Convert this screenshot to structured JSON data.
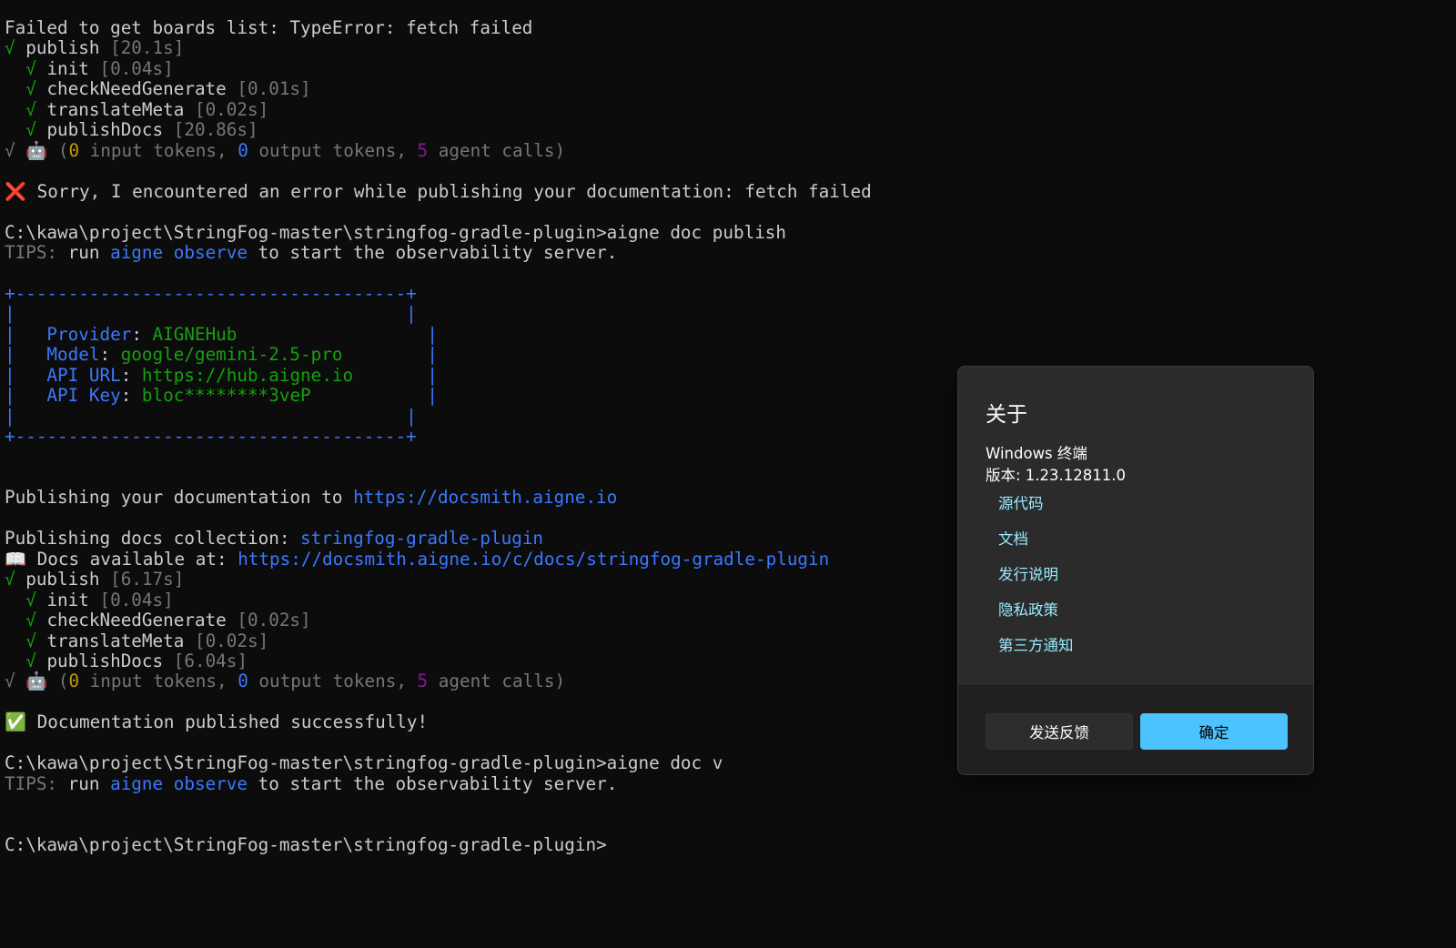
{
  "terminal": {
    "lines": [
      [
        {
          "t": "Failed to get boards list: TypeError: fetch failed",
          "c": "text"
        }
      ],
      [
        {
          "t": "√ ",
          "c": "green"
        },
        {
          "t": "publish ",
          "c": "text"
        },
        {
          "t": "[20.1s]",
          "c": "dim"
        }
      ],
      [
        {
          "t": "  √ ",
          "c": "green"
        },
        {
          "t": "init ",
          "c": "text"
        },
        {
          "t": "[0.04s]",
          "c": "dim"
        }
      ],
      [
        {
          "t": "  √ ",
          "c": "green"
        },
        {
          "t": "checkNeedGenerate ",
          "c": "text"
        },
        {
          "t": "[0.01s]",
          "c": "dim"
        }
      ],
      [
        {
          "t": "  √ ",
          "c": "green"
        },
        {
          "t": "translateMeta ",
          "c": "text"
        },
        {
          "t": "[0.02s]",
          "c": "dim"
        }
      ],
      [
        {
          "t": "  √ ",
          "c": "green"
        },
        {
          "t": "publishDocs ",
          "c": "text"
        },
        {
          "t": "[20.86s]",
          "c": "dim"
        }
      ],
      [
        {
          "t": "√ ",
          "c": "dim"
        },
        {
          "t": "🤖",
          "c": "emoji"
        },
        {
          "t": " (",
          "c": "dim"
        },
        {
          "t": "0",
          "c": "yellow"
        },
        {
          "t": " input tokens, ",
          "c": "dim"
        },
        {
          "t": "0",
          "c": "blue"
        },
        {
          "t": " output tokens, ",
          "c": "dim"
        },
        {
          "t": "5",
          "c": "purple"
        },
        {
          "t": " agent calls)",
          "c": "dim"
        }
      ],
      [],
      [
        {
          "t": "❌",
          "c": "emoji"
        },
        {
          "t": " Sorry, I encountered an error while publishing your documentation: fetch failed",
          "c": "text"
        }
      ],
      [],
      [
        {
          "t": "C:\\kawa\\project\\StringFog-master\\stringfog-gradle-plugin>aigne doc publish",
          "c": "text"
        }
      ],
      [
        {
          "t": "TIPS:",
          "c": "dim"
        },
        {
          "t": " run ",
          "c": "text"
        },
        {
          "t": "aigne observe",
          "c": "blue"
        },
        {
          "t": " to start the observability server.",
          "c": "text"
        }
      ],
      [],
      [
        {
          "t": "+-------------------------------------+",
          "c": "blue"
        }
      ],
      [
        {
          "t": "|                                     |",
          "c": "blue"
        }
      ],
      [
        {
          "t": "|   Provider",
          "c": "blue"
        },
        {
          "t": ": ",
          "c": "text"
        },
        {
          "t": "AIGNEHub",
          "c": "green"
        },
        {
          "t": "                  |",
          "c": "blue"
        }
      ],
      [
        {
          "t": "|   Model",
          "c": "blue"
        },
        {
          "t": ": ",
          "c": "text"
        },
        {
          "t": "google/gemini-2.5-pro",
          "c": "green"
        },
        {
          "t": "        |",
          "c": "blue"
        }
      ],
      [
        {
          "t": "|   API URL",
          "c": "blue"
        },
        {
          "t": ": ",
          "c": "text"
        },
        {
          "t": "https://hub.aigne.io",
          "c": "green"
        },
        {
          "t": "       |",
          "c": "blue"
        }
      ],
      [
        {
          "t": "|   API Key",
          "c": "blue"
        },
        {
          "t": ": ",
          "c": "text"
        },
        {
          "t": "bloc********3veP",
          "c": "green"
        },
        {
          "t": "           |",
          "c": "blue"
        }
      ],
      [
        {
          "t": "|                                     |",
          "c": "blue"
        }
      ],
      [
        {
          "t": "+-------------------------------------+",
          "c": "blue"
        }
      ],
      [],
      [],
      [
        {
          "t": "Publishing your documentation to ",
          "c": "text"
        },
        {
          "t": "https://docsmith.aigne.io",
          "c": "blue"
        }
      ],
      [],
      [
        {
          "t": "Publishing docs collection: ",
          "c": "text"
        },
        {
          "t": "stringfog-gradle-plugin",
          "c": "blue"
        }
      ],
      [
        {
          "t": "📖",
          "c": "emoji"
        },
        {
          "t": " Docs available at: ",
          "c": "text"
        },
        {
          "t": "https://docsmith.aigne.io/c/docs/stringfog-gradle-plugin",
          "c": "blue"
        }
      ],
      [
        {
          "t": "√ ",
          "c": "green"
        },
        {
          "t": "publish ",
          "c": "text"
        },
        {
          "t": "[6.17s]",
          "c": "dim"
        }
      ],
      [
        {
          "t": "  √ ",
          "c": "green"
        },
        {
          "t": "init ",
          "c": "text"
        },
        {
          "t": "[0.04s]",
          "c": "dim"
        }
      ],
      [
        {
          "t": "  √ ",
          "c": "green"
        },
        {
          "t": "checkNeedGenerate ",
          "c": "text"
        },
        {
          "t": "[0.02s]",
          "c": "dim"
        }
      ],
      [
        {
          "t": "  √ ",
          "c": "green"
        },
        {
          "t": "translateMeta ",
          "c": "text"
        },
        {
          "t": "[0.02s]",
          "c": "dim"
        }
      ],
      [
        {
          "t": "  √ ",
          "c": "green"
        },
        {
          "t": "publishDocs ",
          "c": "text"
        },
        {
          "t": "[6.04s]",
          "c": "dim"
        }
      ],
      [
        {
          "t": "√ ",
          "c": "dim"
        },
        {
          "t": "🤖",
          "c": "emoji"
        },
        {
          "t": " (",
          "c": "dim"
        },
        {
          "t": "0",
          "c": "yellow"
        },
        {
          "t": " input tokens, ",
          "c": "dim"
        },
        {
          "t": "0",
          "c": "blue"
        },
        {
          "t": " output tokens, ",
          "c": "dim"
        },
        {
          "t": "5",
          "c": "purple"
        },
        {
          "t": " agent calls)",
          "c": "dim"
        }
      ],
      [],
      [
        {
          "t": "✅",
          "c": "emoji"
        },
        {
          "t": " Documentation published successfully!",
          "c": "text"
        }
      ],
      [],
      [
        {
          "t": "C:\\kawa\\project\\StringFog-master\\stringfog-gradle-plugin>aigne doc v",
          "c": "text"
        }
      ],
      [
        {
          "t": "TIPS:",
          "c": "dim"
        },
        {
          "t": " run ",
          "c": "text"
        },
        {
          "t": "aigne observe",
          "c": "blue"
        },
        {
          "t": " to start the observability server.",
          "c": "text"
        }
      ],
      [],
      [],
      [
        {
          "t": "C:\\kawa\\project\\StringFog-master\\stringfog-gradle-plugin>",
          "c": "text"
        }
      ]
    ]
  },
  "about_dialog": {
    "title": "关于",
    "app_name": "Windows 终端",
    "version": "版本: 1.23.12811.0",
    "links": [
      "源代码",
      "文档",
      "发行说明",
      "隐私政策",
      "第三方通知"
    ],
    "feedback_label": "发送反馈",
    "ok_label": "确定"
  }
}
